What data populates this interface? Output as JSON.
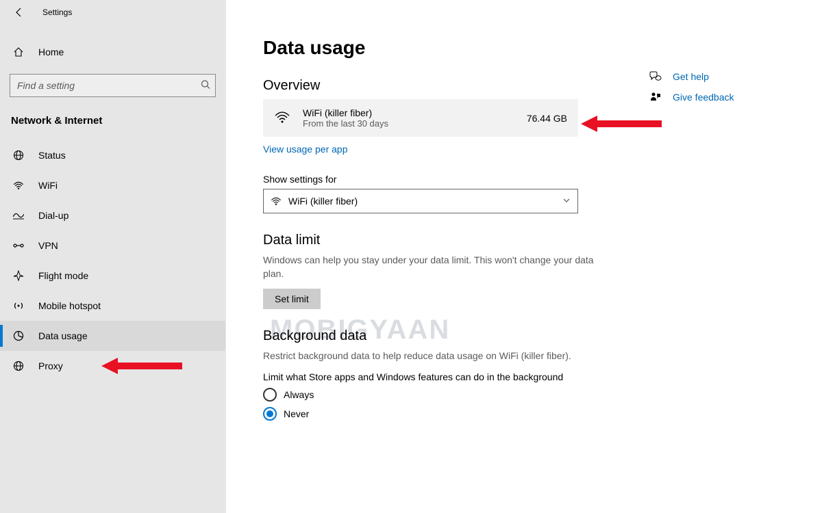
{
  "window": {
    "title": "Settings"
  },
  "sidebar": {
    "home_label": "Home",
    "search_placeholder": "Find a setting",
    "category_title": "Network & Internet",
    "items": [
      {
        "icon": "globe",
        "label": "Status"
      },
      {
        "icon": "wifi",
        "label": "WiFi"
      },
      {
        "icon": "dialup",
        "label": "Dial-up"
      },
      {
        "icon": "vpn",
        "label": "VPN"
      },
      {
        "icon": "flight",
        "label": "Flight mode"
      },
      {
        "icon": "hotspot",
        "label": "Mobile hotspot"
      },
      {
        "icon": "datausage",
        "label": "Data usage"
      },
      {
        "icon": "proxy",
        "label": "Proxy"
      }
    ],
    "selected_index": 6
  },
  "page": {
    "title": "Data usage",
    "overview": {
      "heading": "Overview",
      "network_name": "WiFi (killer fiber)",
      "subtitle": "From the last 30 days",
      "amount": "76.44 GB",
      "view_per_app_link": "View usage per app"
    },
    "show_settings": {
      "label": "Show settings for",
      "selected": "WiFi (killer fiber)"
    },
    "data_limit": {
      "heading": "Data limit",
      "description": "Windows can help you stay under your data limit. This won't change your data plan.",
      "button": "Set limit"
    },
    "background_data": {
      "heading": "Background data",
      "description": "Restrict background data to help reduce data usage on WiFi (killer fiber).",
      "limit_label": "Limit what Store apps and Windows features can do in the background",
      "options": [
        {
          "label": "Always",
          "checked": false
        },
        {
          "label": "Never",
          "checked": true
        }
      ]
    }
  },
  "help": {
    "get_help": "Get help",
    "give_feedback": "Give feedback"
  },
  "watermark_text": "MOBIGYAAN"
}
